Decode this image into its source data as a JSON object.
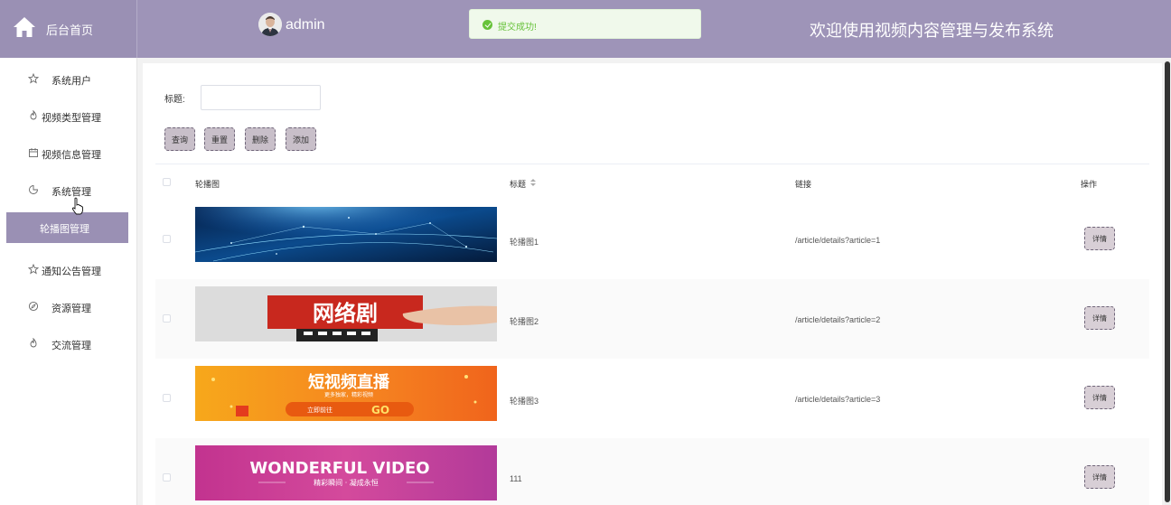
{
  "header": {
    "home_label": "后台首页",
    "admin_name": "admin",
    "toast_text": "提交成功!",
    "site_title": "欢迎使用视频内容管理与发布系统"
  },
  "sidebar": {
    "items": [
      {
        "label": "系统用户",
        "icon": "star-icon"
      },
      {
        "label": "视频类型管理",
        "icon": "fire-icon"
      },
      {
        "label": "视频信息管理",
        "icon": "calendar-icon"
      },
      {
        "label": "系统管理",
        "icon": "pie-chart-icon"
      },
      {
        "label": "通知公告管理",
        "icon": "star-icon"
      },
      {
        "label": "资源管理",
        "icon": "compass-icon"
      },
      {
        "label": "交流管理",
        "icon": "fire-icon"
      }
    ],
    "active_submenu": "轮播图管理"
  },
  "filter": {
    "label": "标题:",
    "value": "",
    "placeholder": ""
  },
  "buttons": {
    "query": "查询",
    "reset": "重置",
    "delete": "删除",
    "add": "添加"
  },
  "table": {
    "headers": {
      "image": "轮播图",
      "title": "标题",
      "link": "链接",
      "action": "操作"
    },
    "rows": [
      {
        "image_desc": "blue-globe-network",
        "title": "轮播图1",
        "link": "/article/details?article=1",
        "action": "详情"
      },
      {
        "image_desc": "web-drama",
        "banner_text": "网络剧",
        "title": "轮播图2",
        "link": "/article/details?article=2",
        "action": "详情"
      },
      {
        "image_desc": "short-video-live",
        "banner_text": "短视频直播",
        "banner_sub": "更多独家，精彩视频",
        "banner_btn": "立即前往",
        "banner_go": "GO",
        "title": "轮播图3",
        "link": "/article/details?article=3",
        "action": "详情"
      },
      {
        "image_desc": "wonderful-video",
        "banner_text": "WONDERFUL VIDEO",
        "banner_sub": "精彩瞬间 · 凝成永恒",
        "title": "111",
        "link": "",
        "action": "详情"
      }
    ]
  },
  "colors": {
    "header_bg": "#9e94b8",
    "accent": "#9a90b4",
    "toast_success": "#67c23a",
    "button_bg": "#c8bfc9"
  }
}
